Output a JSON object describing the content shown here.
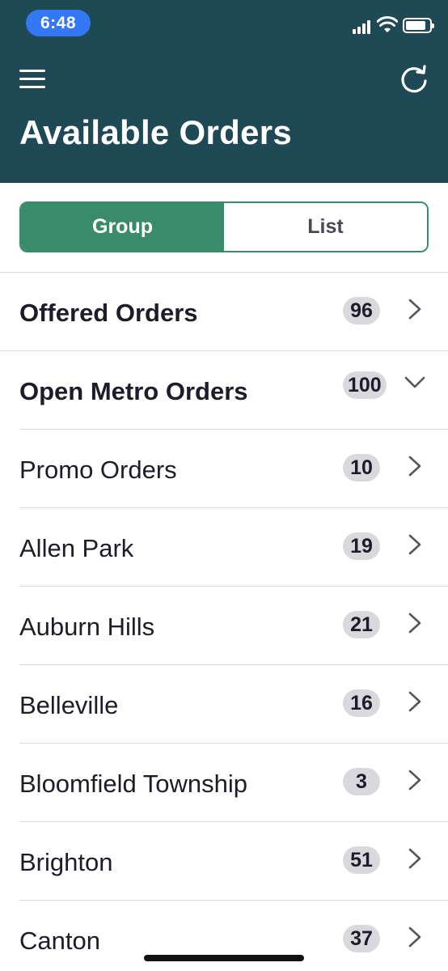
{
  "status_bar": {
    "time": "6:48"
  },
  "header": {
    "title": "Available Orders",
    "background": "#1f4a55"
  },
  "segmented": {
    "options": [
      "Group",
      "List"
    ],
    "selected": "Group",
    "accent": "#3a8a6c"
  },
  "rows": [
    {
      "label": "Offered Orders",
      "count": "96",
      "bold": true,
      "chevron": "chevron-right-icon"
    },
    {
      "label": "Open Metro Orders",
      "count": "100",
      "bold": true,
      "chevron": "chevron-down-icon"
    },
    {
      "label": "Promo Orders",
      "count": "10",
      "bold": false,
      "chevron": "chevron-right-icon"
    },
    {
      "label": "Allen Park",
      "count": "19",
      "bold": false,
      "chevron": "chevron-right-icon"
    },
    {
      "label": "Auburn Hills",
      "count": "21",
      "bold": false,
      "chevron": "chevron-right-icon"
    },
    {
      "label": "Belleville",
      "count": "16",
      "bold": false,
      "chevron": "chevron-right-icon"
    },
    {
      "label": "Bloomfield Township",
      "count": "3",
      "bold": false,
      "chevron": "chevron-right-icon"
    },
    {
      "label": "Brighton",
      "count": "51",
      "bold": false,
      "chevron": "chevron-right-icon"
    },
    {
      "label": "Canton",
      "count": "37",
      "bold": false,
      "chevron": "chevron-right-icon"
    }
  ]
}
